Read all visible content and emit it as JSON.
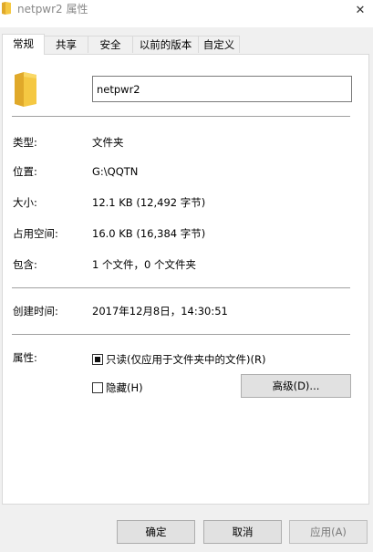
{
  "window": {
    "title": "netpwr2 属性",
    "close_glyph": "✕"
  },
  "tabs": [
    {
      "label": "常规",
      "active": true
    },
    {
      "label": "共享",
      "active": false
    },
    {
      "label": "安全",
      "active": false
    },
    {
      "label": "以前的版本",
      "active": false
    },
    {
      "label": "自定义",
      "active": false
    }
  ],
  "general": {
    "folder_name": "netpwr2",
    "type": {
      "label": "类型:",
      "value": "文件夹"
    },
    "location": {
      "label": "位置:",
      "value": "G:\\QQTN"
    },
    "size": {
      "label": "大小:",
      "value": "12.1 KB (12,492 字节)"
    },
    "size_on_disk": {
      "label": "占用空间:",
      "value": "16.0 KB (16,384 字节)"
    },
    "contains": {
      "label": "包含:",
      "value": "1 个文件，0 个文件夹"
    },
    "created": {
      "label": "创建时间:",
      "value": "2017年12月8日，14:30:51"
    },
    "attributes": {
      "label": "属性:",
      "readonly_label": "只读(仅应用于文件夹中的文件)(R)",
      "readonly_state": "indeterminate",
      "hidden_label": "隐藏(H)",
      "hidden_state": "unchecked",
      "advanced_button": "高级(D)..."
    }
  },
  "footer": {
    "ok": "确定",
    "cancel": "取消",
    "apply": "应用(A)"
  },
  "colors": {
    "folder_body": "#f5c842",
    "folder_dark": "#e0a92a",
    "panel_border": "#d9d9d9",
    "separator": "#a0a0a0"
  }
}
